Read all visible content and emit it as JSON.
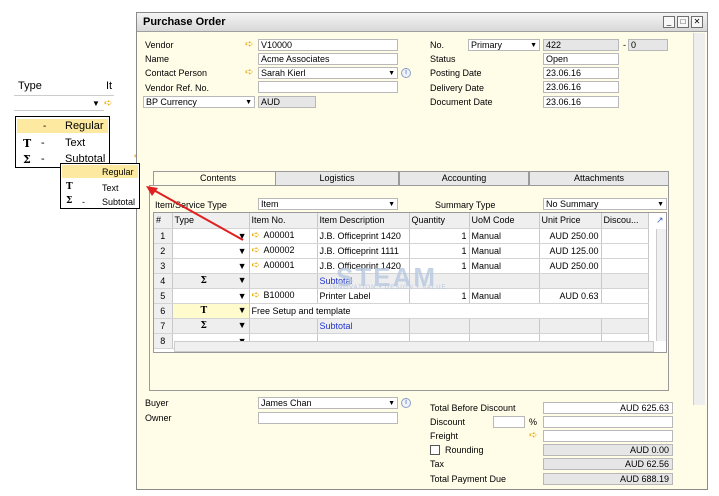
{
  "window": {
    "title": "Purchase Order"
  },
  "header": {
    "vendor_label": "Vendor",
    "vendor_value": "V10000",
    "name_label": "Name",
    "name_value": "Acme Associates",
    "contact_label": "Contact Person",
    "contact_value": "Sarah Kierl",
    "vendor_ref_label": "Vendor Ref. No.",
    "vendor_ref_value": "",
    "currency_label": "BP Currency",
    "currency_value": "AUD",
    "no_label": "No.",
    "series_value": "Primary",
    "doc_number": "422",
    "doc_suffix": "0",
    "status_label": "Status",
    "status_value": "Open",
    "posting_label": "Posting Date",
    "posting_value": "23.06.16",
    "delivery_label": "Delivery Date",
    "delivery_value": "23.06.16",
    "docdate_label": "Document Date",
    "docdate_value": "23.06.16"
  },
  "tabs": [
    "Contents",
    "Logistics",
    "Accounting",
    "Attachments"
  ],
  "contents": {
    "item_type_label": "Item/Service Type",
    "item_type_value": "Item",
    "summary_label": "Summary Type",
    "summary_value": "No Summary",
    "columns": [
      "#",
      "Type",
      "Item No.",
      "Item Description",
      "Quantity",
      "UoM Code",
      "Unit Price",
      "Discou..."
    ],
    "rows": [
      {
        "n": "1",
        "type": "",
        "item": "A00001",
        "desc": "J.B. Officeprint 1420",
        "qty": "1",
        "uom": "Manual",
        "price": "AUD 250.00"
      },
      {
        "n": "2",
        "type": "",
        "item": "A00002",
        "desc": "J.B. Officeprint 1111",
        "qty": "1",
        "uom": "Manual",
        "price": "AUD 125.00"
      },
      {
        "n": "3",
        "type": "",
        "item": "A00001",
        "desc": "J.B. Officeprint 1420",
        "qty": "1",
        "uom": "Manual",
        "price": "AUD 250.00"
      },
      {
        "n": "4",
        "type": "Σ",
        "item": "",
        "desc": "Subtotal",
        "qty": "",
        "uom": "",
        "price": ""
      },
      {
        "n": "5",
        "type": "",
        "item": "B10000",
        "desc": "Printer Label",
        "qty": "1",
        "uom": "Manual",
        "price": "AUD 0.63"
      },
      {
        "n": "6",
        "type": "T",
        "item": "Free Setup and template",
        "desc": "",
        "qty": "",
        "uom": "",
        "price": ""
      },
      {
        "n": "7",
        "type": "Σ",
        "item": "",
        "desc": "Subtotal",
        "qty": "",
        "uom": "",
        "price": ""
      },
      {
        "n": "8",
        "type": "",
        "item": "",
        "desc": "",
        "qty": "",
        "uom": "",
        "price": ""
      }
    ]
  },
  "footer": {
    "buyer_label": "Buyer",
    "buyer_value": "James Chan",
    "owner_label": "Owner",
    "owner_value": "",
    "total_before_label": "Total Before Discount",
    "total_before_value": "AUD 625.63",
    "discount_label": "Discount",
    "discount_pct": "%",
    "freight_label": "Freight",
    "rounding_label": "Rounding",
    "rounding_value": "AUD 0.00",
    "tax_label": "Tax",
    "tax_value": "AUD 62.56",
    "total_due_label": "Total Payment Due",
    "total_due_value": "AUD 688.19"
  },
  "callout": {
    "type_header": "Type",
    "it_header": "It",
    "options": [
      {
        "symbol": "-",
        "label": "Regular"
      },
      {
        "symbol": "T",
        "label": "Text"
      },
      {
        "symbol": "Σ",
        "label": "Subtotal"
      }
    ]
  },
  "watermark": {
    "text": "STEAM",
    "sub": "INNOVATION • DESIGN • VALUE"
  }
}
